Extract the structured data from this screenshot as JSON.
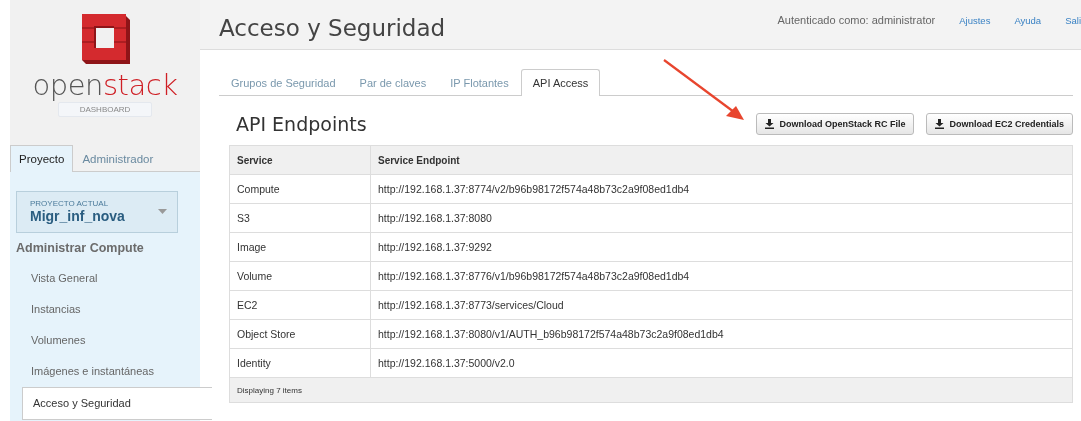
{
  "logo": {
    "word_start": "open",
    "word_end": "stack",
    "badge": "DASHBOARD"
  },
  "sidebar": {
    "tabs": [
      {
        "label": "Proyecto",
        "selected": true
      },
      {
        "label": "Administrador",
        "selected": false
      }
    ],
    "project": {
      "caption": "PROYECTO ACTUAL",
      "name": "Migr_inf_nova"
    },
    "section": "Administrar Compute",
    "items": [
      {
        "label": "Vista General",
        "selected": false
      },
      {
        "label": "Instancias",
        "selected": false
      },
      {
        "label": "Volumenes",
        "selected": false
      },
      {
        "label": "Imágenes e instantáneas",
        "selected": false
      },
      {
        "label": "Acceso y Seguridad",
        "selected": true
      }
    ]
  },
  "header": {
    "title": "Acceso y Seguridad",
    "user": "Autenticado como: administrator",
    "links": [
      "Ajustes",
      "Ayuda",
      "Sali"
    ]
  },
  "tabs": [
    {
      "label": "Grupos de Seguridad",
      "selected": false
    },
    {
      "label": "Par de claves",
      "selected": false
    },
    {
      "label": "IP Flotantes",
      "selected": false
    },
    {
      "label": "API Access",
      "selected": true
    }
  ],
  "panel": {
    "title": "API Endpoints",
    "buttons": [
      "Download OpenStack RC File",
      "Download EC2 Credentials"
    ]
  },
  "table": {
    "columns": [
      "Service",
      "Service Endpoint"
    ],
    "rows": [
      [
        "Compute",
        "http://192.168.1.37:8774/v2/b96b98172f574a48b73c2a9f08ed1db4"
      ],
      [
        "S3",
        "http://192.168.1.37:8080"
      ],
      [
        "Image",
        "http://192.168.1.37:9292"
      ],
      [
        "Volume",
        "http://192.168.1.37:8776/v1/b96b98172f574a48b73c2a9f08ed1db4"
      ],
      [
        "EC2",
        "http://192.168.1.37:8773/services/Cloud"
      ],
      [
        "Object Store",
        "http://192.168.1.37:8080/v1/AUTH_b96b98172f574a48b73c2a9f08ed1db4"
      ],
      [
        "Identity",
        "http://192.168.1.37:5000/v2.0"
      ]
    ],
    "footer": "Displaying 7 items"
  }
}
